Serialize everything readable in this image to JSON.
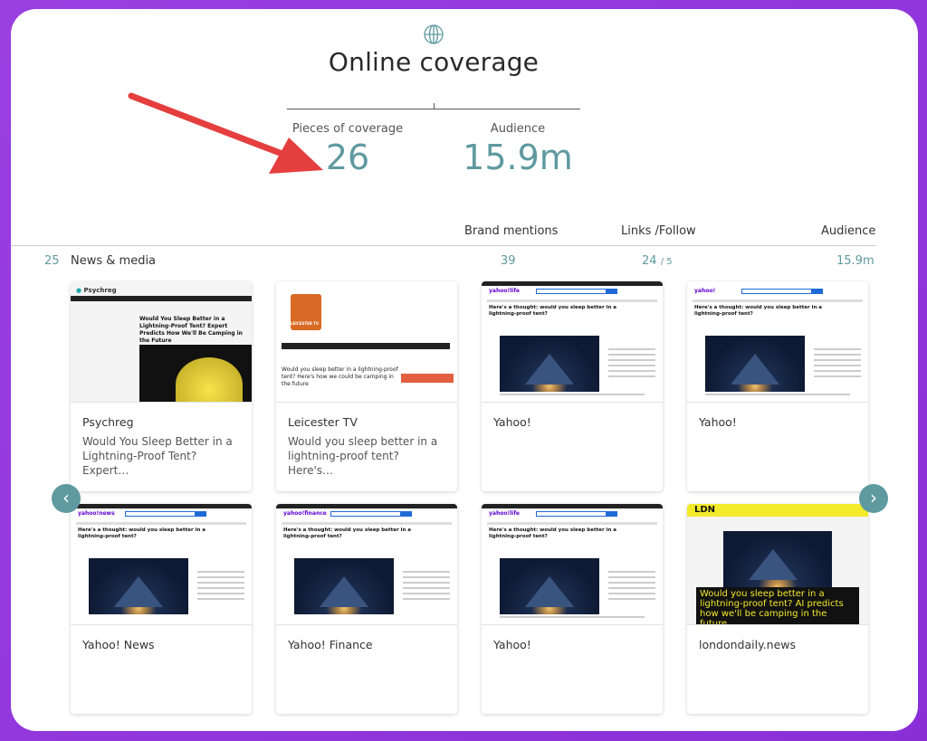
{
  "header": {
    "icon": "globe-icon",
    "title": "Online coverage"
  },
  "metrics": {
    "pieces_label": "Pieces of coverage",
    "pieces_value": "26",
    "audience_label": "Audience",
    "audience_value": "15.9m"
  },
  "columns": {
    "brand_mentions": "Brand mentions",
    "links_follow": "Links /Follow",
    "audience": "Audience"
  },
  "category_row": {
    "count": "25",
    "name": "News & media",
    "brand_mentions": "39",
    "links": "24",
    "follow": "/ 5",
    "audience": "15.9m"
  },
  "cards": [
    {
      "outlet": "Psychreg",
      "headline": "Would You Sleep Better in a Lightning-Proof Tent? Expert…",
      "thumb_title": "Would You Sleep Better in a Lightning-Proof Tent? Expert Predicts How We'll Be Camping in the Future",
      "thumb_logo": "Psychreg"
    },
    {
      "outlet": "Leicester TV",
      "headline": "Would you sleep better in a lightning-proof tent? Here's…",
      "thumb_title": "Would you sleep better in a lightning-proof tent? Here's how we could be camping in the future"
    },
    {
      "outlet": "Yahoo!",
      "headline": "",
      "thumb_logo": "yahoo!life",
      "thumb_title": "Here's a thought: would you sleep better in a lightning-proof tent?"
    },
    {
      "outlet": "Yahoo!",
      "headline": "",
      "thumb_logo": "yahoo!",
      "thumb_title": "Here's a thought: would you sleep better in a lightning-proof tent?"
    },
    {
      "outlet": "Yahoo! News",
      "headline": "",
      "thumb_logo": "yahoo!news",
      "thumb_title": "Here's a thought: would you sleep better in a lightning-proof tent?"
    },
    {
      "outlet": "Yahoo! Finance",
      "headline": "",
      "thumb_logo": "yahoo!finance",
      "thumb_title": "Here's a thought: would you sleep better in a lightning-proof tent?"
    },
    {
      "outlet": "Yahoo!",
      "headline": "",
      "thumb_logo": "yahoo!life",
      "thumb_title": "Here's a thought: would you sleep better in a lightning-proof tent?"
    },
    {
      "outlet": "londondaily.news",
      "headline": "",
      "thumb_logo": "LDN",
      "thumb_title": "Would you sleep better in a lightning-proof tent? AI predicts how we'll be camping in the future"
    }
  ],
  "nav": {
    "prev": "‹",
    "next": "›"
  },
  "colors": {
    "accent": "#5f9aa0",
    "frame": "#9a3fe0",
    "arrow": "#e53e3e"
  }
}
